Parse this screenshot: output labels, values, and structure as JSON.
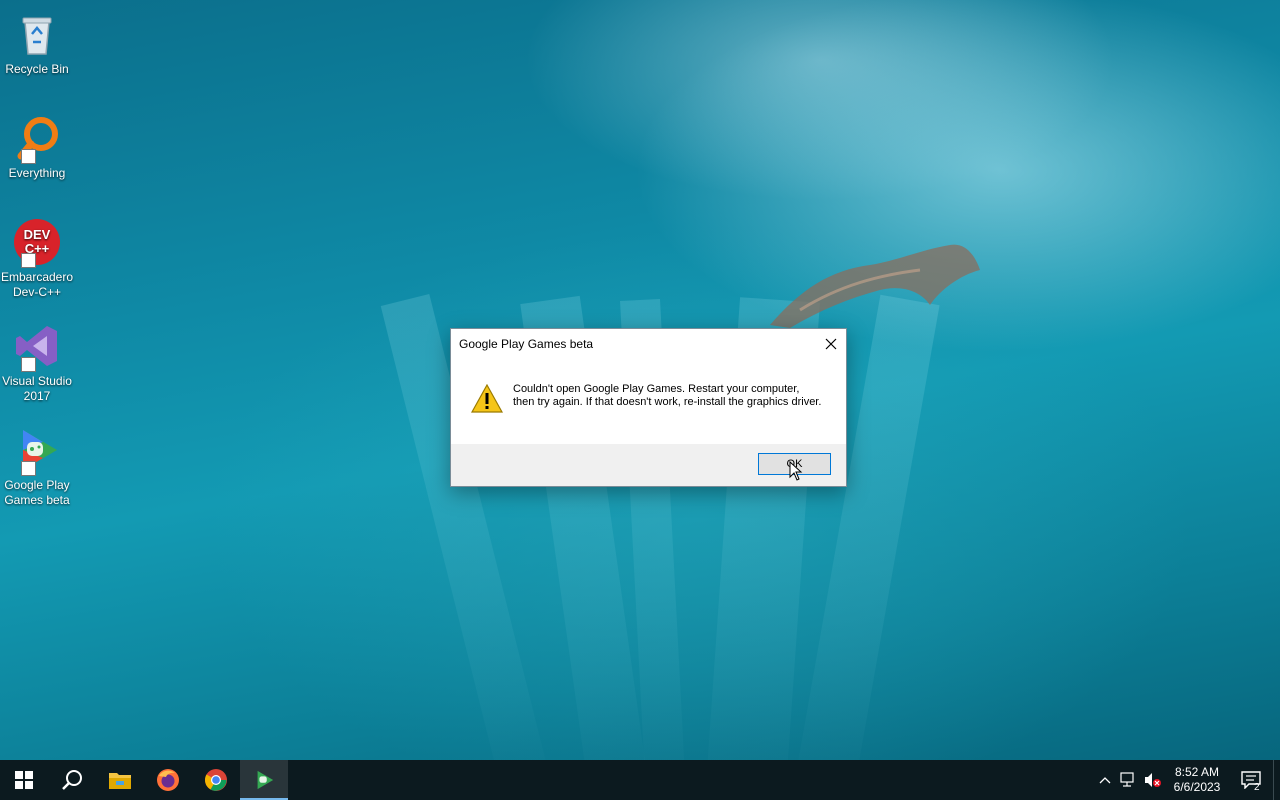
{
  "desktop": {
    "icons": [
      {
        "label": "Recycle Bin",
        "icon": "recycle-bin-icon"
      },
      {
        "label": "Everything",
        "icon": "everything-search-icon"
      },
      {
        "label": "Embarcadero Dev-C++",
        "icon": "devcpp-icon",
        "badge": "DEV C++"
      },
      {
        "label": "Visual Studio 2017",
        "icon": "visual-studio-icon"
      },
      {
        "label": "Google Play Games beta",
        "icon": "google-play-games-icon"
      }
    ]
  },
  "dialog": {
    "title": "Google Play Games beta",
    "message": "Couldn't open Google Play Games. Restart your computer, then try again. If that doesn't work, re-install the graphics driver.",
    "ok_label": "OK",
    "icon": "warning-icon"
  },
  "taskbar": {
    "apps": [
      {
        "name": "start",
        "icon": "windows-logo-icon"
      },
      {
        "name": "search",
        "icon": "search-icon"
      },
      {
        "name": "file-explorer",
        "icon": "folder-icon"
      },
      {
        "name": "firefox",
        "icon": "firefox-icon"
      },
      {
        "name": "chrome",
        "icon": "chrome-icon"
      },
      {
        "name": "google-play-games",
        "icon": "google-play-games-icon",
        "active": true
      }
    ],
    "tray": {
      "time": "8:52 AM",
      "date": "6/6/2023",
      "notification_count": "2"
    }
  },
  "colors": {
    "taskbar_bg": "#0c1a1f",
    "ok_border": "#0078d7",
    "dialog_footer": "#f0f0f0"
  }
}
